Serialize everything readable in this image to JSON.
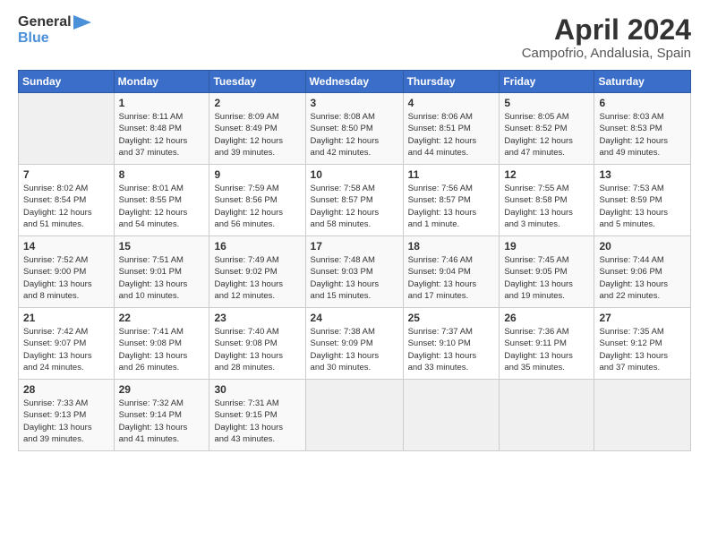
{
  "header": {
    "logo_line1": "General",
    "logo_line2": "Blue",
    "month_title": "April 2024",
    "location": "Campofrio, Andalusia, Spain"
  },
  "calendar": {
    "days_of_week": [
      "Sunday",
      "Monday",
      "Tuesday",
      "Wednesday",
      "Thursday",
      "Friday",
      "Saturday"
    ],
    "weeks": [
      [
        {
          "day": "",
          "info": ""
        },
        {
          "day": "1",
          "info": "Sunrise: 8:11 AM\nSunset: 8:48 PM\nDaylight: 12 hours\nand 37 minutes."
        },
        {
          "day": "2",
          "info": "Sunrise: 8:09 AM\nSunset: 8:49 PM\nDaylight: 12 hours\nand 39 minutes."
        },
        {
          "day": "3",
          "info": "Sunrise: 8:08 AM\nSunset: 8:50 PM\nDaylight: 12 hours\nand 42 minutes."
        },
        {
          "day": "4",
          "info": "Sunrise: 8:06 AM\nSunset: 8:51 PM\nDaylight: 12 hours\nand 44 minutes."
        },
        {
          "day": "5",
          "info": "Sunrise: 8:05 AM\nSunset: 8:52 PM\nDaylight: 12 hours\nand 47 minutes."
        },
        {
          "day": "6",
          "info": "Sunrise: 8:03 AM\nSunset: 8:53 PM\nDaylight: 12 hours\nand 49 minutes."
        }
      ],
      [
        {
          "day": "7",
          "info": "Sunrise: 8:02 AM\nSunset: 8:54 PM\nDaylight: 12 hours\nand 51 minutes."
        },
        {
          "day": "8",
          "info": "Sunrise: 8:01 AM\nSunset: 8:55 PM\nDaylight: 12 hours\nand 54 minutes."
        },
        {
          "day": "9",
          "info": "Sunrise: 7:59 AM\nSunset: 8:56 PM\nDaylight: 12 hours\nand 56 minutes."
        },
        {
          "day": "10",
          "info": "Sunrise: 7:58 AM\nSunset: 8:57 PM\nDaylight: 12 hours\nand 58 minutes."
        },
        {
          "day": "11",
          "info": "Sunrise: 7:56 AM\nSunset: 8:57 PM\nDaylight: 13 hours\nand 1 minute."
        },
        {
          "day": "12",
          "info": "Sunrise: 7:55 AM\nSunset: 8:58 PM\nDaylight: 13 hours\nand 3 minutes."
        },
        {
          "day": "13",
          "info": "Sunrise: 7:53 AM\nSunset: 8:59 PM\nDaylight: 13 hours\nand 5 minutes."
        }
      ],
      [
        {
          "day": "14",
          "info": "Sunrise: 7:52 AM\nSunset: 9:00 PM\nDaylight: 13 hours\nand 8 minutes."
        },
        {
          "day": "15",
          "info": "Sunrise: 7:51 AM\nSunset: 9:01 PM\nDaylight: 13 hours\nand 10 minutes."
        },
        {
          "day": "16",
          "info": "Sunrise: 7:49 AM\nSunset: 9:02 PM\nDaylight: 13 hours\nand 12 minutes."
        },
        {
          "day": "17",
          "info": "Sunrise: 7:48 AM\nSunset: 9:03 PM\nDaylight: 13 hours\nand 15 minutes."
        },
        {
          "day": "18",
          "info": "Sunrise: 7:46 AM\nSunset: 9:04 PM\nDaylight: 13 hours\nand 17 minutes."
        },
        {
          "day": "19",
          "info": "Sunrise: 7:45 AM\nSunset: 9:05 PM\nDaylight: 13 hours\nand 19 minutes."
        },
        {
          "day": "20",
          "info": "Sunrise: 7:44 AM\nSunset: 9:06 PM\nDaylight: 13 hours\nand 22 minutes."
        }
      ],
      [
        {
          "day": "21",
          "info": "Sunrise: 7:42 AM\nSunset: 9:07 PM\nDaylight: 13 hours\nand 24 minutes."
        },
        {
          "day": "22",
          "info": "Sunrise: 7:41 AM\nSunset: 9:08 PM\nDaylight: 13 hours\nand 26 minutes."
        },
        {
          "day": "23",
          "info": "Sunrise: 7:40 AM\nSunset: 9:08 PM\nDaylight: 13 hours\nand 28 minutes."
        },
        {
          "day": "24",
          "info": "Sunrise: 7:38 AM\nSunset: 9:09 PM\nDaylight: 13 hours\nand 30 minutes."
        },
        {
          "day": "25",
          "info": "Sunrise: 7:37 AM\nSunset: 9:10 PM\nDaylight: 13 hours\nand 33 minutes."
        },
        {
          "day": "26",
          "info": "Sunrise: 7:36 AM\nSunset: 9:11 PM\nDaylight: 13 hours\nand 35 minutes."
        },
        {
          "day": "27",
          "info": "Sunrise: 7:35 AM\nSunset: 9:12 PM\nDaylight: 13 hours\nand 37 minutes."
        }
      ],
      [
        {
          "day": "28",
          "info": "Sunrise: 7:33 AM\nSunset: 9:13 PM\nDaylight: 13 hours\nand 39 minutes."
        },
        {
          "day": "29",
          "info": "Sunrise: 7:32 AM\nSunset: 9:14 PM\nDaylight: 13 hours\nand 41 minutes."
        },
        {
          "day": "30",
          "info": "Sunrise: 7:31 AM\nSunset: 9:15 PM\nDaylight: 13 hours\nand 43 minutes."
        },
        {
          "day": "",
          "info": ""
        },
        {
          "day": "",
          "info": ""
        },
        {
          "day": "",
          "info": ""
        },
        {
          "day": "",
          "info": ""
        }
      ]
    ]
  }
}
